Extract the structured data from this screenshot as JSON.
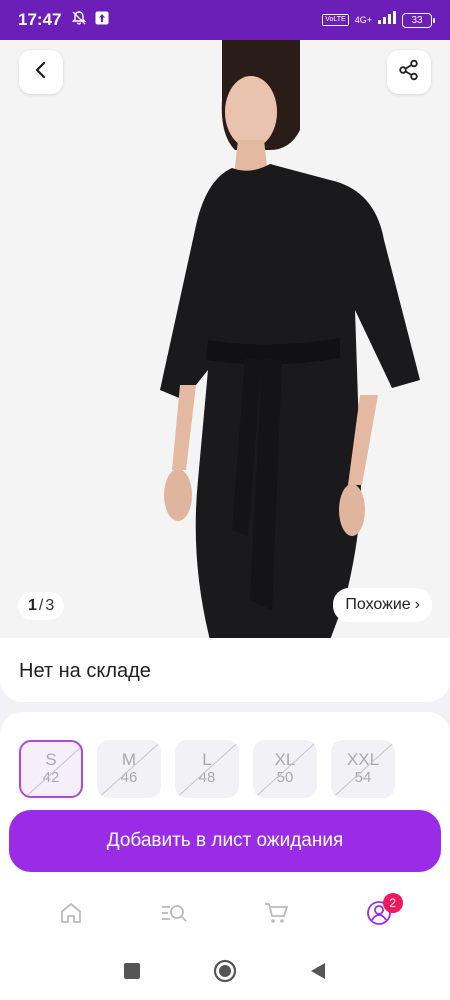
{
  "status_bar": {
    "time": "17:47",
    "network": "4G+",
    "volte": "VoLTE",
    "battery": "33"
  },
  "gallery": {
    "current": "1",
    "separator": "/",
    "total": "3",
    "similar_label": "Похожие",
    "similar_chevron": "›"
  },
  "stock": {
    "text": "Нет на складе"
  },
  "sizes": [
    {
      "name": "S",
      "ru": "42",
      "selected": true,
      "available": false
    },
    {
      "name": "M",
      "ru": "46",
      "selected": false,
      "available": false
    },
    {
      "name": "L",
      "ru": "48",
      "selected": false,
      "available": false
    },
    {
      "name": "XL",
      "ru": "50",
      "selected": false,
      "available": false
    },
    {
      "name": "XXL",
      "ru": "54",
      "selected": false,
      "available": false
    }
  ],
  "cta": {
    "label": "Добавить в лист ожидания"
  },
  "bottom_nav": {
    "items": [
      "home-icon",
      "catalog-search-icon",
      "cart-icon",
      "profile-icon"
    ],
    "profile_badge": "2"
  },
  "colors": {
    "brand": "#6b1fb8",
    "accent": "#9a2ce8",
    "badge": "#f0185d"
  }
}
